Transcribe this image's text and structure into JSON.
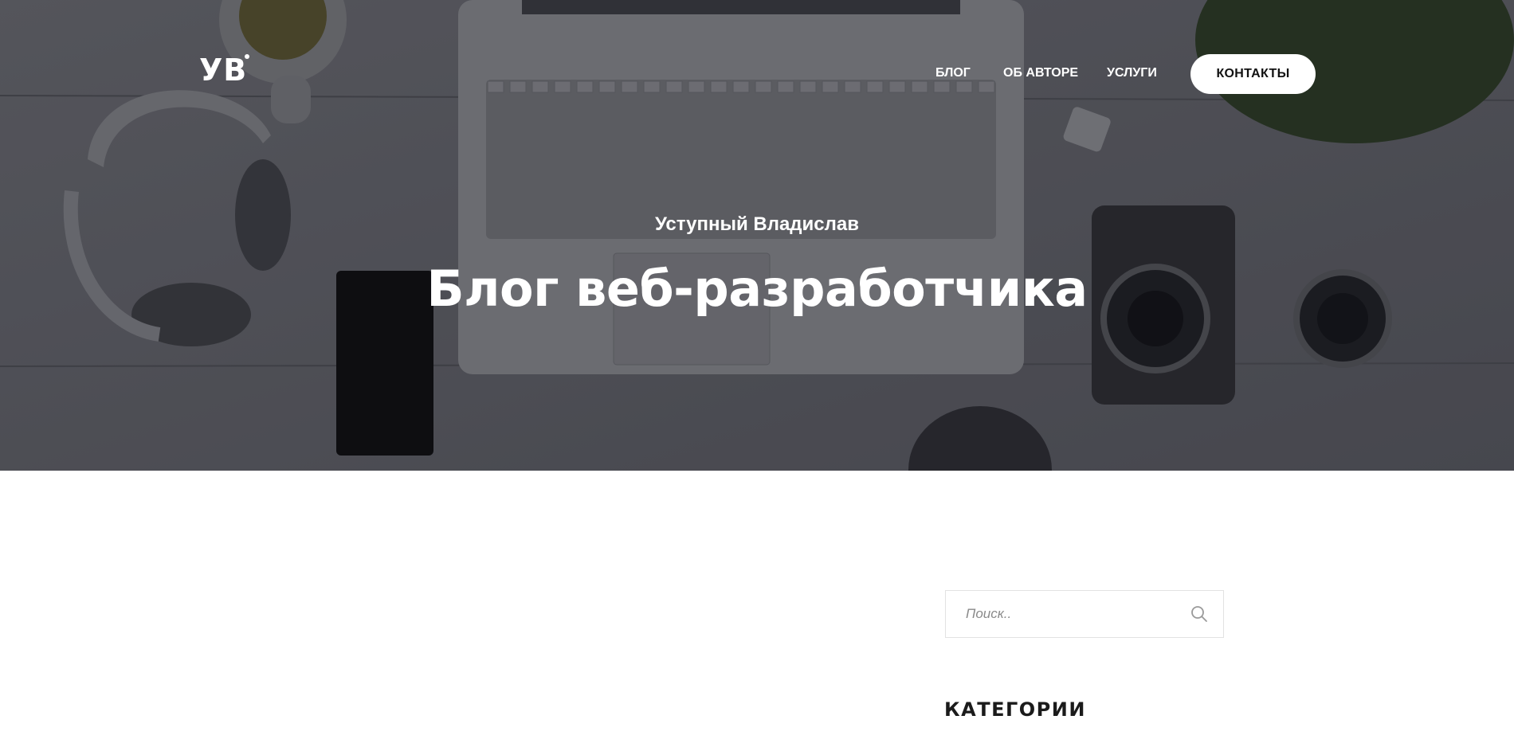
{
  "header": {
    "logo_text": "УВ",
    "nav": [
      {
        "label": "БЛОГ"
      },
      {
        "label": "ОБ АВТОРЕ"
      },
      {
        "label": "УСЛУГИ"
      }
    ],
    "cta_label": "КОНТАКТЫ"
  },
  "hero": {
    "subtitle": "Уступный Владислав",
    "title": "Блог веб-разработчика"
  },
  "sidebar": {
    "search_placeholder": "Поиск..",
    "categories_title": "КАТЕГОРИИ"
  },
  "icons": {
    "search": "search-icon"
  }
}
